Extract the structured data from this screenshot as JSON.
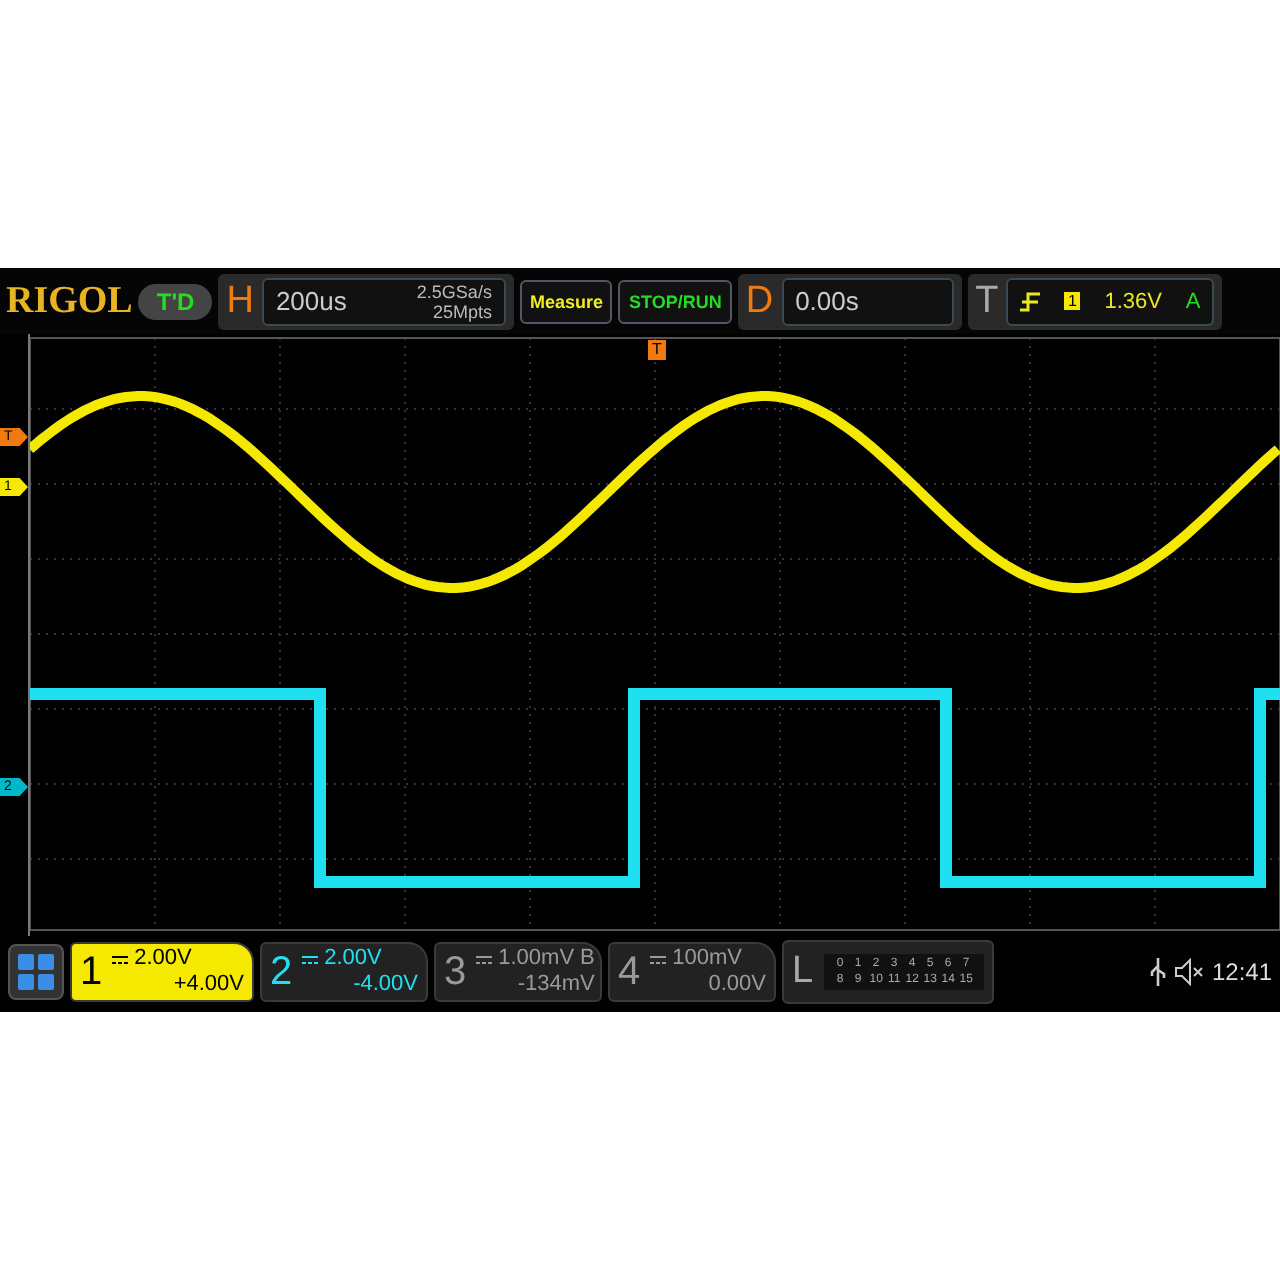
{
  "brand": "RIGOL",
  "trigger_status": "T'D",
  "horizontal": {
    "label": "H",
    "timebase": "200us",
    "sample_rate": "2.5GSa/s",
    "memory": "25Mpts"
  },
  "buttons": [
    "Measure",
    "STOP/RUN"
  ],
  "delay": {
    "label": "D",
    "value": "0.00s"
  },
  "trigger": {
    "label": "T",
    "source": "1",
    "level": "1.36V",
    "mode": "A"
  },
  "top_marker": "T",
  "left_markers": [
    {
      "label": "T",
      "color": "#f07a10"
    },
    {
      "label": "1",
      "color": "#f5e900"
    },
    {
      "label": "2",
      "color": "#00b8c8"
    }
  ],
  "channels": [
    {
      "number": "1",
      "scale": "2.00V",
      "offset": "+4.00V",
      "color": "#f5e900",
      "selected": true
    },
    {
      "number": "2",
      "scale": "2.00V",
      "offset": "-4.00V",
      "color": "#1ee0f0",
      "selected": false
    },
    {
      "number": "3",
      "scale": "1.00mV",
      "suffix": "B",
      "offset": "-134mV",
      "color": "#9a9a9a",
      "selected": false
    },
    {
      "number": "4",
      "scale": "100mV",
      "offset": "0.00V",
      "color": "#9a9a9a",
      "selected": false
    }
  ],
  "logic": {
    "label": "L",
    "rows": [
      [
        "0",
        "1",
        "2",
        "3",
        "4",
        "5",
        "6",
        "7"
      ],
      [
        "8",
        "9",
        "10",
        "11",
        "12",
        "13",
        "14",
        "15"
      ]
    ]
  },
  "clock": "12:41"
}
